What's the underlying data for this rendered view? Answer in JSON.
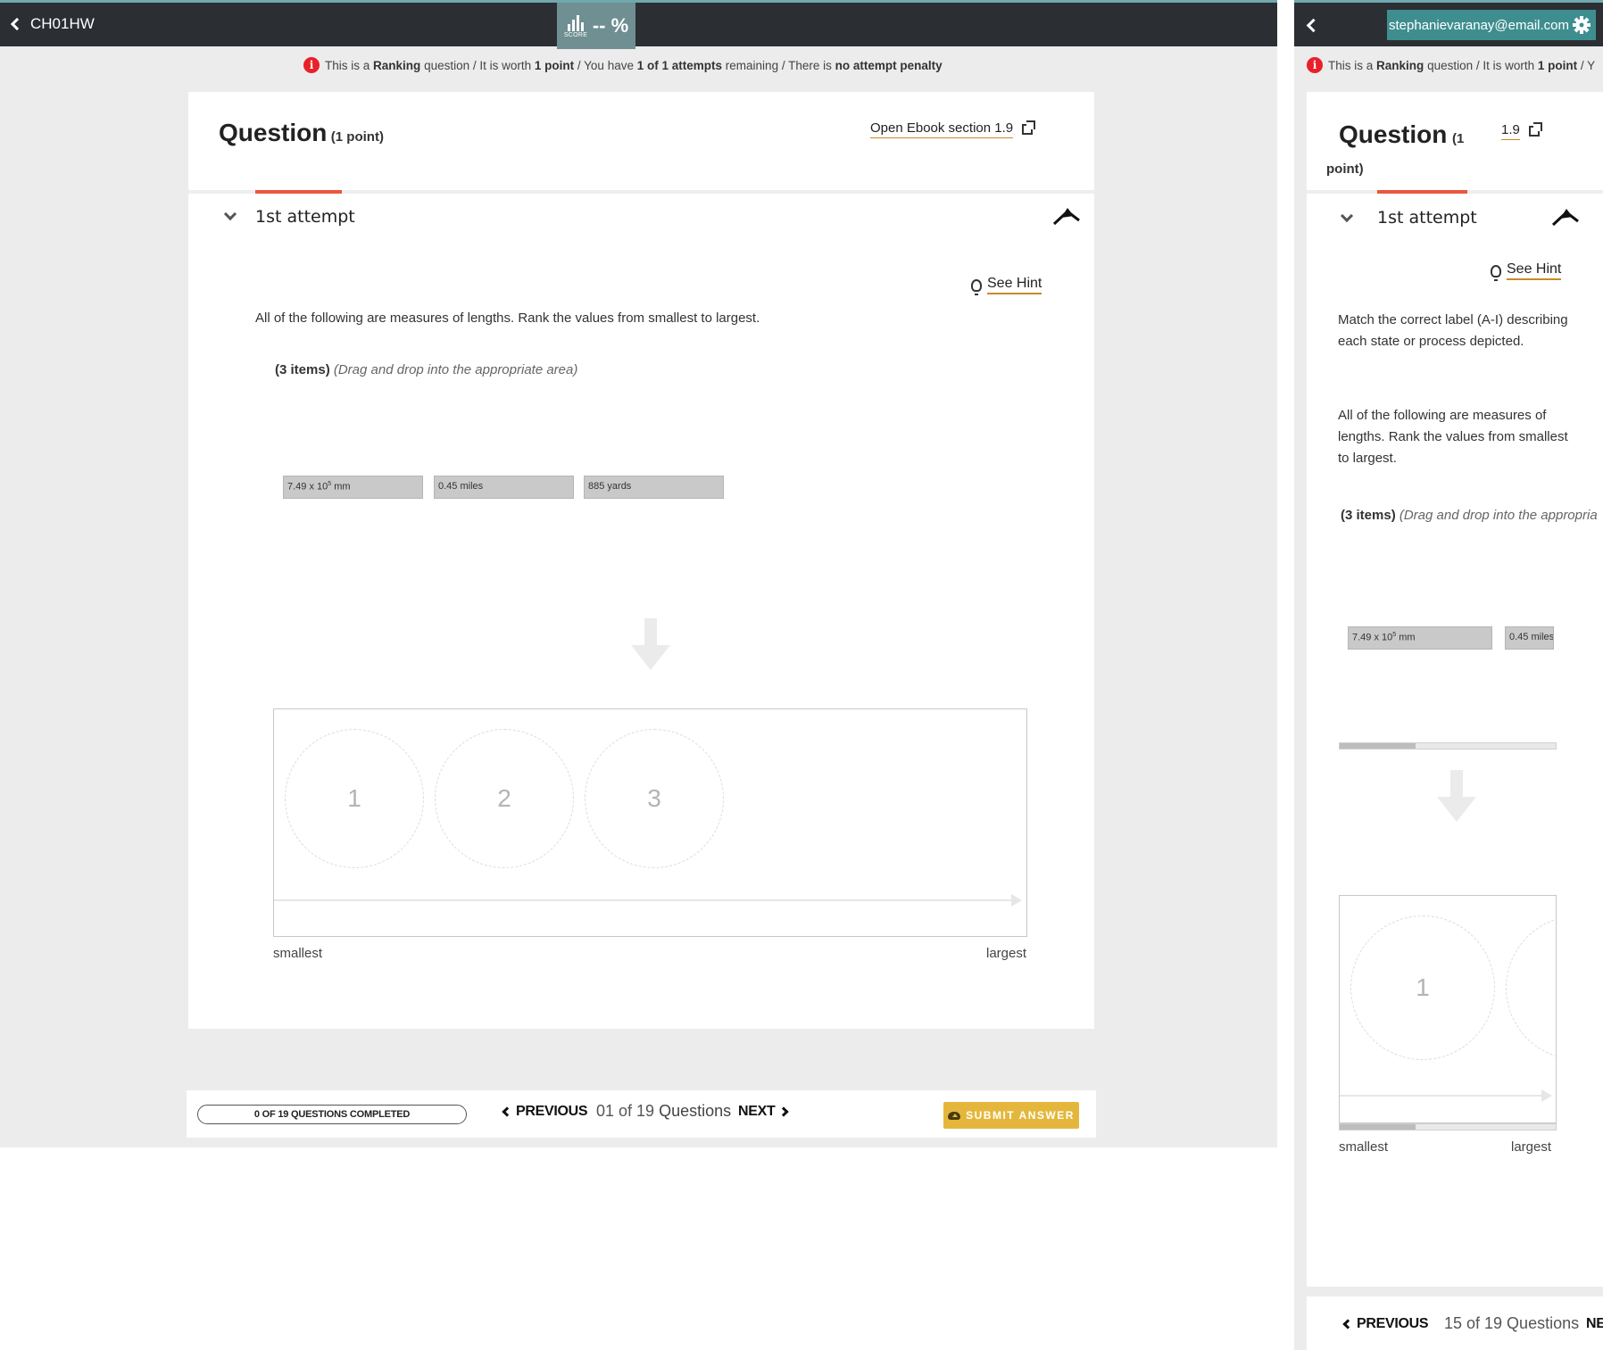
{
  "left": {
    "header": {
      "back_label": "CH01HW",
      "score_word": "SCORE",
      "score_value": "-- %"
    },
    "info": {
      "p1": "This is a",
      "type": "Ranking",
      "p2": "question /  It is worth",
      "worth": "1 point",
      "p3": "/  You have",
      "attempts": "1 of 1 attempts",
      "p4": "remaining  /  There is",
      "penalty": "no attempt penalty"
    },
    "question": {
      "title": "Question",
      "points": "(1 point)",
      "ebook_label": "Open Ebook section",
      "ebook_section": "1.9"
    },
    "attempt": {
      "label": "1st attempt"
    },
    "hint": {
      "label": "See Hint"
    },
    "prompt": "All of the following are measures of lengths.  Rank the values from smallest to largest.",
    "items": {
      "count": "(3 items)",
      "instruction": "(Drag and drop into the appropriate area)"
    },
    "chips": [
      {
        "base": "7.49 x 10",
        "exp": "5",
        "unit": "mm"
      },
      {
        "text": "0.45 miles"
      },
      {
        "text": "885 yards"
      }
    ],
    "slots": [
      "1",
      "2",
      "3"
    ],
    "axis": {
      "min_label": "smallest",
      "max_label": "largest"
    },
    "footer": {
      "progress": "0 OF 19 QUESTIONS COMPLETED",
      "prev": "PREVIOUS",
      "count_num": "01 of 19",
      "count_word": "Questions",
      "next": "NEXT",
      "submit": "SUBMIT ANSWER"
    }
  },
  "right": {
    "header": {
      "email": "stephanievaranay@email.com"
    },
    "info": {
      "p1": "This is a",
      "type": "Ranking",
      "p2": "question /  It is worth",
      "worth": "1 point",
      "p3": "/ Y"
    },
    "question": {
      "title": "Question",
      "points_a": "(1",
      "points_b": "point)",
      "ebook_section": "1.9"
    },
    "attempt": {
      "label": "1st attempt"
    },
    "hint": {
      "label": "See Hint"
    },
    "prompt1": "Match the correct label (A-I) describing each state or process depicted.",
    "prompt2": "All of the following are measures of lengths.  Rank the values from smallest to largest.",
    "items": {
      "count": "(3 items)",
      "instruction": "(Drag and drop into the appropria"
    },
    "chips": [
      {
        "base": "7.49 x 10",
        "exp": "5",
        "unit": "mm"
      },
      {
        "text": "0.45 miles"
      }
    ],
    "scroll_progress": 0.35,
    "slots": [
      "1"
    ],
    "axis": {
      "min_label": "smallest",
      "max_label": "largest"
    },
    "footer": {
      "prev": "PREVIOUS",
      "count": "15 of 19 Questions",
      "next": "NE"
    }
  }
}
